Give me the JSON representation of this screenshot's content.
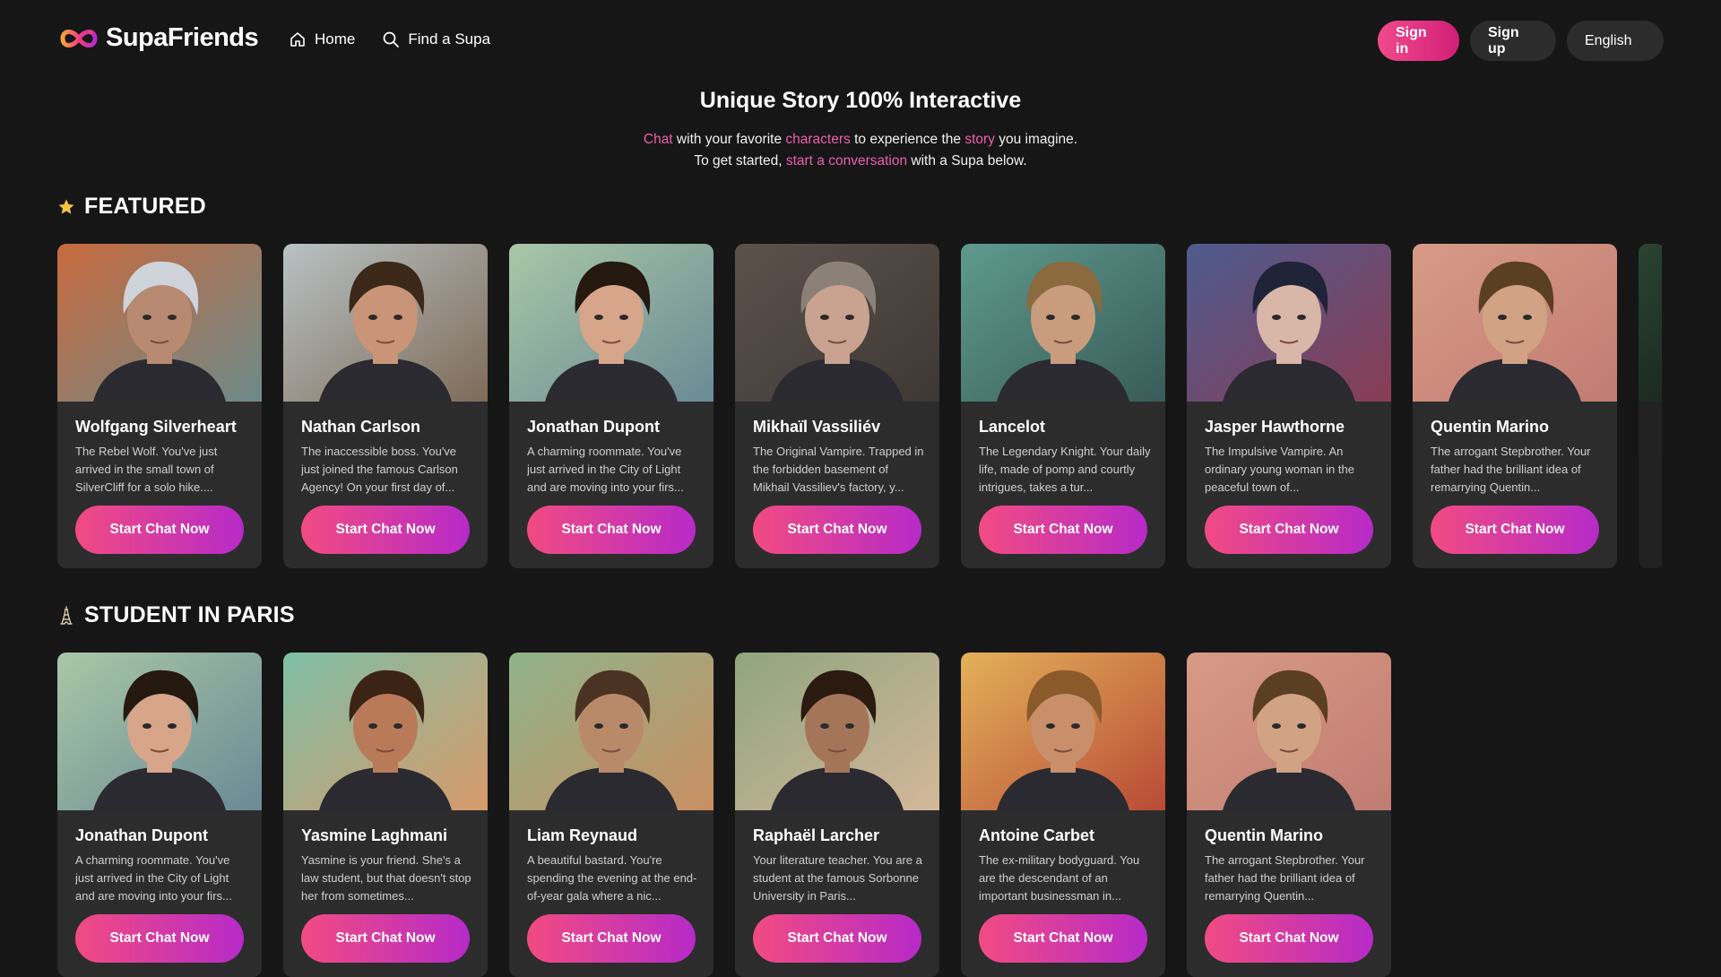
{
  "header": {
    "brand": "SupaFriends",
    "nav": [
      {
        "label": "Home",
        "icon": "home-icon"
      },
      {
        "label": "Find a Supa",
        "icon": "search-icon"
      }
    ],
    "signin": "Sign in",
    "signup": "Sign up",
    "language": "English"
  },
  "hero": {
    "title": "Unique Story 100% Interactive",
    "line1": {
      "w1": "Chat",
      "t1": " with your favorite ",
      "w2": "characters",
      "t2": " to experience the ",
      "w3": "story",
      "t3": " you imagine."
    },
    "line2": {
      "t1": "To get started, ",
      "w1": "start a conversation",
      "t2": " with a Supa below."
    }
  },
  "colors": {
    "accent": "#ee5fae",
    "button_from": "#f24b82",
    "button_to": "#b62ac8",
    "card_bg": "#2c2c2c",
    "page_bg": "#161616"
  },
  "sections": [
    {
      "title": "FEATURED",
      "icon": "star-icon",
      "cards": [
        {
          "name": "Wolfgang Silverheart",
          "desc": "The Rebel Wolf. You've just arrived in the small town of SilverCliff for a solo hike....",
          "button": "Start Chat Now",
          "hair": "#cfd3da",
          "skin": "#b88a72",
          "bg1": "#c86a3e",
          "bg2": "#6d8a8a"
        },
        {
          "name": "Nathan Carlson",
          "desc": "The inaccessible boss. You've just joined the famous Carlson Agency! On your first day of...",
          "button": "Start Chat Now",
          "hair": "#3b2818",
          "skin": "#c99478",
          "bg1": "#b9c2c4",
          "bg2": "#7e6b58"
        },
        {
          "name": "Jonathan Dupont",
          "desc": "A charming roommate. You've just arrived in the City of Light and are moving into your firs...",
          "button": "Start Chat Now",
          "hair": "#24180f",
          "skin": "#d7a58a",
          "bg1": "#a9c7a6",
          "bg2": "#6a8a96"
        },
        {
          "name": "Mikhaïl Vassiliév",
          "desc": "The Original Vampire. Trapped in the forbidden basement of Mikhail Vassiliev's factory, y...",
          "button": "Start Chat Now",
          "hair": "#8c8178",
          "skin": "#c9a38f",
          "bg1": "#5c524c",
          "bg2": "#3e3834"
        },
        {
          "name": "Lancelot",
          "desc": "The Legendary Knight. Your daily life, made of pomp and courtly intrigues, takes a tur...",
          "button": "Start Chat Now",
          "hair": "#8a6a3e",
          "skin": "#c99c7e",
          "bg1": "#5f9a8e",
          "bg2": "#385b58"
        },
        {
          "name": "Jasper Hawthorne",
          "desc": "The Impulsive Vampire. An ordinary young woman in the peaceful town of...",
          "button": "Start Chat Now",
          "hair": "#1e2338",
          "skin": "#d8b6a8",
          "bg1": "#4d5b8f",
          "bg2": "#8a3c54"
        },
        {
          "name": "Quentin Marino",
          "desc": "The arrogant Stepbrother. Your father had the brilliant idea of remarrying Quentin...",
          "button": "Start Chat Now",
          "hair": "#5a3f22",
          "skin": "#d1a284",
          "bg1": "#d89a86",
          "bg2": "#c17c72"
        }
      ]
    },
    {
      "title": "STUDENT IN PARIS",
      "icon": "eiffel-tower-icon",
      "cards": [
        {
          "name": "Jonathan Dupont",
          "desc": "A charming roommate. You've just arrived in the City of Light and are moving into your firs...",
          "button": "Start Chat Now",
          "hair": "#24180f",
          "skin": "#d7a58a",
          "bg1": "#a9c7a6",
          "bg2": "#6a8a96"
        },
        {
          "name": "Yasmine Laghmani",
          "desc": "Yasmine is your friend. She's a law student, but that doesn't stop her from sometimes...",
          "button": "Start Chat Now",
          "hair": "#3b2415",
          "skin": "#b97a5a",
          "bg1": "#7fbfa6",
          "bg2": "#d79a6a"
        },
        {
          "name": "Liam Reynaud",
          "desc": "A beautiful bastard. You're spending the evening at the end-of-year gala where a nic...",
          "button": "Start Chat Now",
          "hair": "#4a3322",
          "skin": "#b98a6a",
          "bg1": "#8fb38a",
          "bg2": "#c98f62"
        },
        {
          "name": "Raphaël Larcher",
          "desc": "Your literature teacher. You are a student at the famous Sorbonne University in Paris...",
          "button": "Start Chat Now",
          "hair": "#2a1a10",
          "skin": "#a5755a",
          "bg1": "#8fa57e",
          "bg2": "#d4b79a"
        },
        {
          "name": "Antoine Carbet",
          "desc": "The ex-military bodyguard. You are the descendant of an important businessman in...",
          "button": "Start Chat Now",
          "hair": "#8a5a2a",
          "skin": "#c98e6a",
          "bg1": "#e3b25a",
          "bg2": "#b94a36"
        },
        {
          "name": "Quentin Marino",
          "desc": "The arrogant Stepbrother. Your father had the brilliant idea of remarrying Quentin...",
          "button": "Start Chat Now",
          "hair": "#5a3f22",
          "skin": "#d1a284",
          "bg1": "#d89a86",
          "bg2": "#c17c72"
        }
      ]
    }
  ]
}
